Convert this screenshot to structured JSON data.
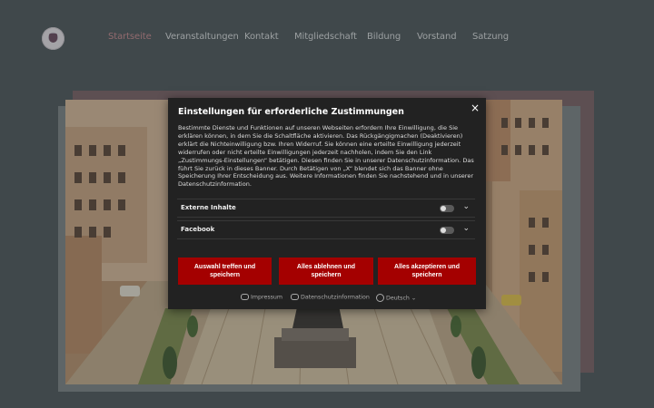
{
  "nav": {
    "items": [
      "Startseite",
      "Veranstaltungen",
      "Kontakt",
      "Mitgliedschaft",
      "Bildung",
      "Vorstand",
      "Satzung"
    ],
    "active": "Startseite"
  },
  "modal": {
    "title": "Einstellungen für erforderliche Zustimmungen",
    "description": "Bestimmte Dienste und Funktionen auf unseren Webseiten erfordern Ihre Einwilligung, die Sie erklären können, in dem Sie die Schaltfläche aktivieren. Das Rückgängigmachen (Deaktivieren) erklärt die Nichteinwilligung bzw. Ihren Widerruf. Sie können eine erteilte Einwilligung jederzeit widerrufen oder nicht erteilte Einwilligungen jederzeit nachholen, indem Sie den Link „Zustimmungs-Einstellungen“ betätigen. Diesen finden Sie in unserer Datenschutzinformation. Das führt Sie zurück in dieses Banner. Durch Betätigen von „X“ blendet sich das Banner ohne Speicherung Ihrer Entscheidung aus. Weitere Informationen finden Sie nachstehend und in unserer Datenschutzinformation.",
    "consents": [
      {
        "label": "Externe Inhalte",
        "enabled": false
      },
      {
        "label": "Facebook",
        "enabled": false
      }
    ],
    "buttons": {
      "select": "Auswahl treffen und speichern",
      "reject": "Alles ablehnen und speichern",
      "accept": "Alles akzeptieren und speichern"
    },
    "footer": {
      "impressum": "Impressum",
      "privacy": "Datenschutzinformation",
      "language": "Deutsch"
    },
    "close_glyph": "×"
  },
  "colors": {
    "background": "#4d575a",
    "nav_active": "#c98a8f",
    "button": "#a40000",
    "modal_bg": "#222222"
  }
}
